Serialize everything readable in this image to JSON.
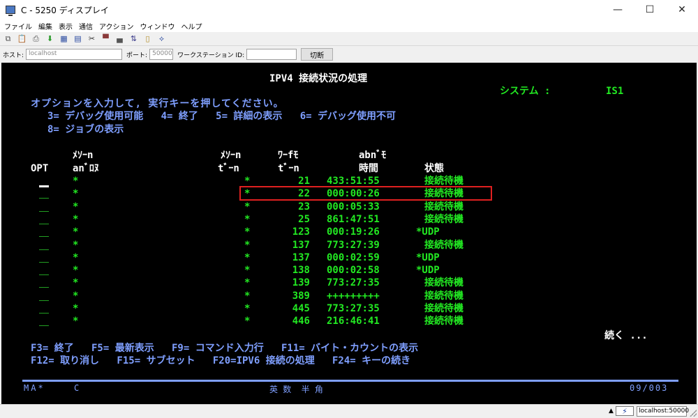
{
  "window": {
    "title": "C - 5250 ディスプレイ",
    "minimize": "—",
    "maximize": "☐",
    "close": "✕"
  },
  "menu": [
    "ファイル",
    "編集",
    "表示",
    "通信",
    "アクション",
    "ウィンドウ",
    "ヘルプ"
  ],
  "toolbar_icons": [
    "copy-icon",
    "paste-icon",
    "print-icon",
    "download-icon",
    "screen-icon",
    "table-icon",
    "macro-icon",
    "send-icon",
    "receive-icon",
    "transfer-icon",
    "document-icon",
    "help-icon"
  ],
  "connection": {
    "host_label": "ホスト:",
    "host_value": "localhost",
    "port_label": "ポート:",
    "port_value": "50000",
    "ws_label": "ワークステーション ID:",
    "ws_value": "",
    "disconnect_label": "切断"
  },
  "screen": {
    "title": "IPV4 接続状況の処理",
    "system_label": "システム :",
    "system_value": "IS1",
    "instruction": "オプションを入力して, 実行キーを押してください。",
    "options_line1": "3= デバッグ使用可能   4= 終了   5= 詳細の表示   6= デバッグ使用不可",
    "options_line2": "8= ジョブの表示",
    "headers": {
      "remote_address_top": "ﾒｿｰn",
      "remote_address_bottom": "anﾞﾛﾇ",
      "opt": "OPT",
      "remote_port_top": "ﾒｿｰn",
      "remote_port_bottom": "tﾞｰn",
      "local_port_top": "ﾜｰfﾓ",
      "local_port_bottom": "tﾞｰn",
      "idle_time_top": "abnﾞﾓ",
      "idle_time_bottom": "時間",
      "state": "状態"
    },
    "rows": [
      {
        "remote_address": "*",
        "remote_port": "*",
        "local_port": "21",
        "idle_time": "433:51:55",
        "state": "接続待機"
      },
      {
        "remote_address": "*",
        "remote_port": "*",
        "local_port": "22",
        "idle_time": "000:00:26",
        "state": "接続待機"
      },
      {
        "remote_address": "*",
        "remote_port": "*",
        "local_port": "23",
        "idle_time": "000:05:33",
        "state": "接続待機"
      },
      {
        "remote_address": "*",
        "remote_port": "*",
        "local_port": "25",
        "idle_time": "861:47:51",
        "state": "接続待機"
      },
      {
        "remote_address": "*",
        "remote_port": "*",
        "local_port": "123",
        "idle_time": "000:19:26",
        "state": "*UDP"
      },
      {
        "remote_address": "*",
        "remote_port": "*",
        "local_port": "137",
        "idle_time": "773:27:39",
        "state": "接続待機"
      },
      {
        "remote_address": "*",
        "remote_port": "*",
        "local_port": "137",
        "idle_time": "000:02:59",
        "state": "*UDP"
      },
      {
        "remote_address": "*",
        "remote_port": "*",
        "local_port": "138",
        "idle_time": "000:02:58",
        "state": "*UDP"
      },
      {
        "remote_address": "*",
        "remote_port": "*",
        "local_port": "139",
        "idle_time": "773:27:35",
        "state": "接続待機"
      },
      {
        "remote_address": "*",
        "remote_port": "*",
        "local_port": "389",
        "idle_time": "+++++++++",
        "state": "接続待機"
      },
      {
        "remote_address": "*",
        "remote_port": "*",
        "local_port": "445",
        "idle_time": "773:27:35",
        "state": "接続待機"
      },
      {
        "remote_address": "*",
        "remote_port": "*",
        "local_port": "446",
        "idle_time": "216:46:41",
        "state": "接続待機"
      }
    ],
    "more": "続く ...",
    "fkeys_line1": "F3= 終了   F5= 最新表示   F9= コマンド入力行   F11= バイト・カウントの表示",
    "fkeys_line2": "F12= 取り消し   F15= サブセット   F20=IPV6 接続の処理   F24= キーの続き",
    "status_left": "MA*",
    "status_c": "C",
    "status_mode": "英 数  半 角",
    "status_pos": "09/003"
  },
  "statusbar": {
    "arrow": "▲",
    "host": "localhost:50000"
  },
  "colors": {
    "blue": "#7f9fff",
    "green": "#22e822",
    "white": "#ffffff",
    "highlight": "#e02020"
  }
}
